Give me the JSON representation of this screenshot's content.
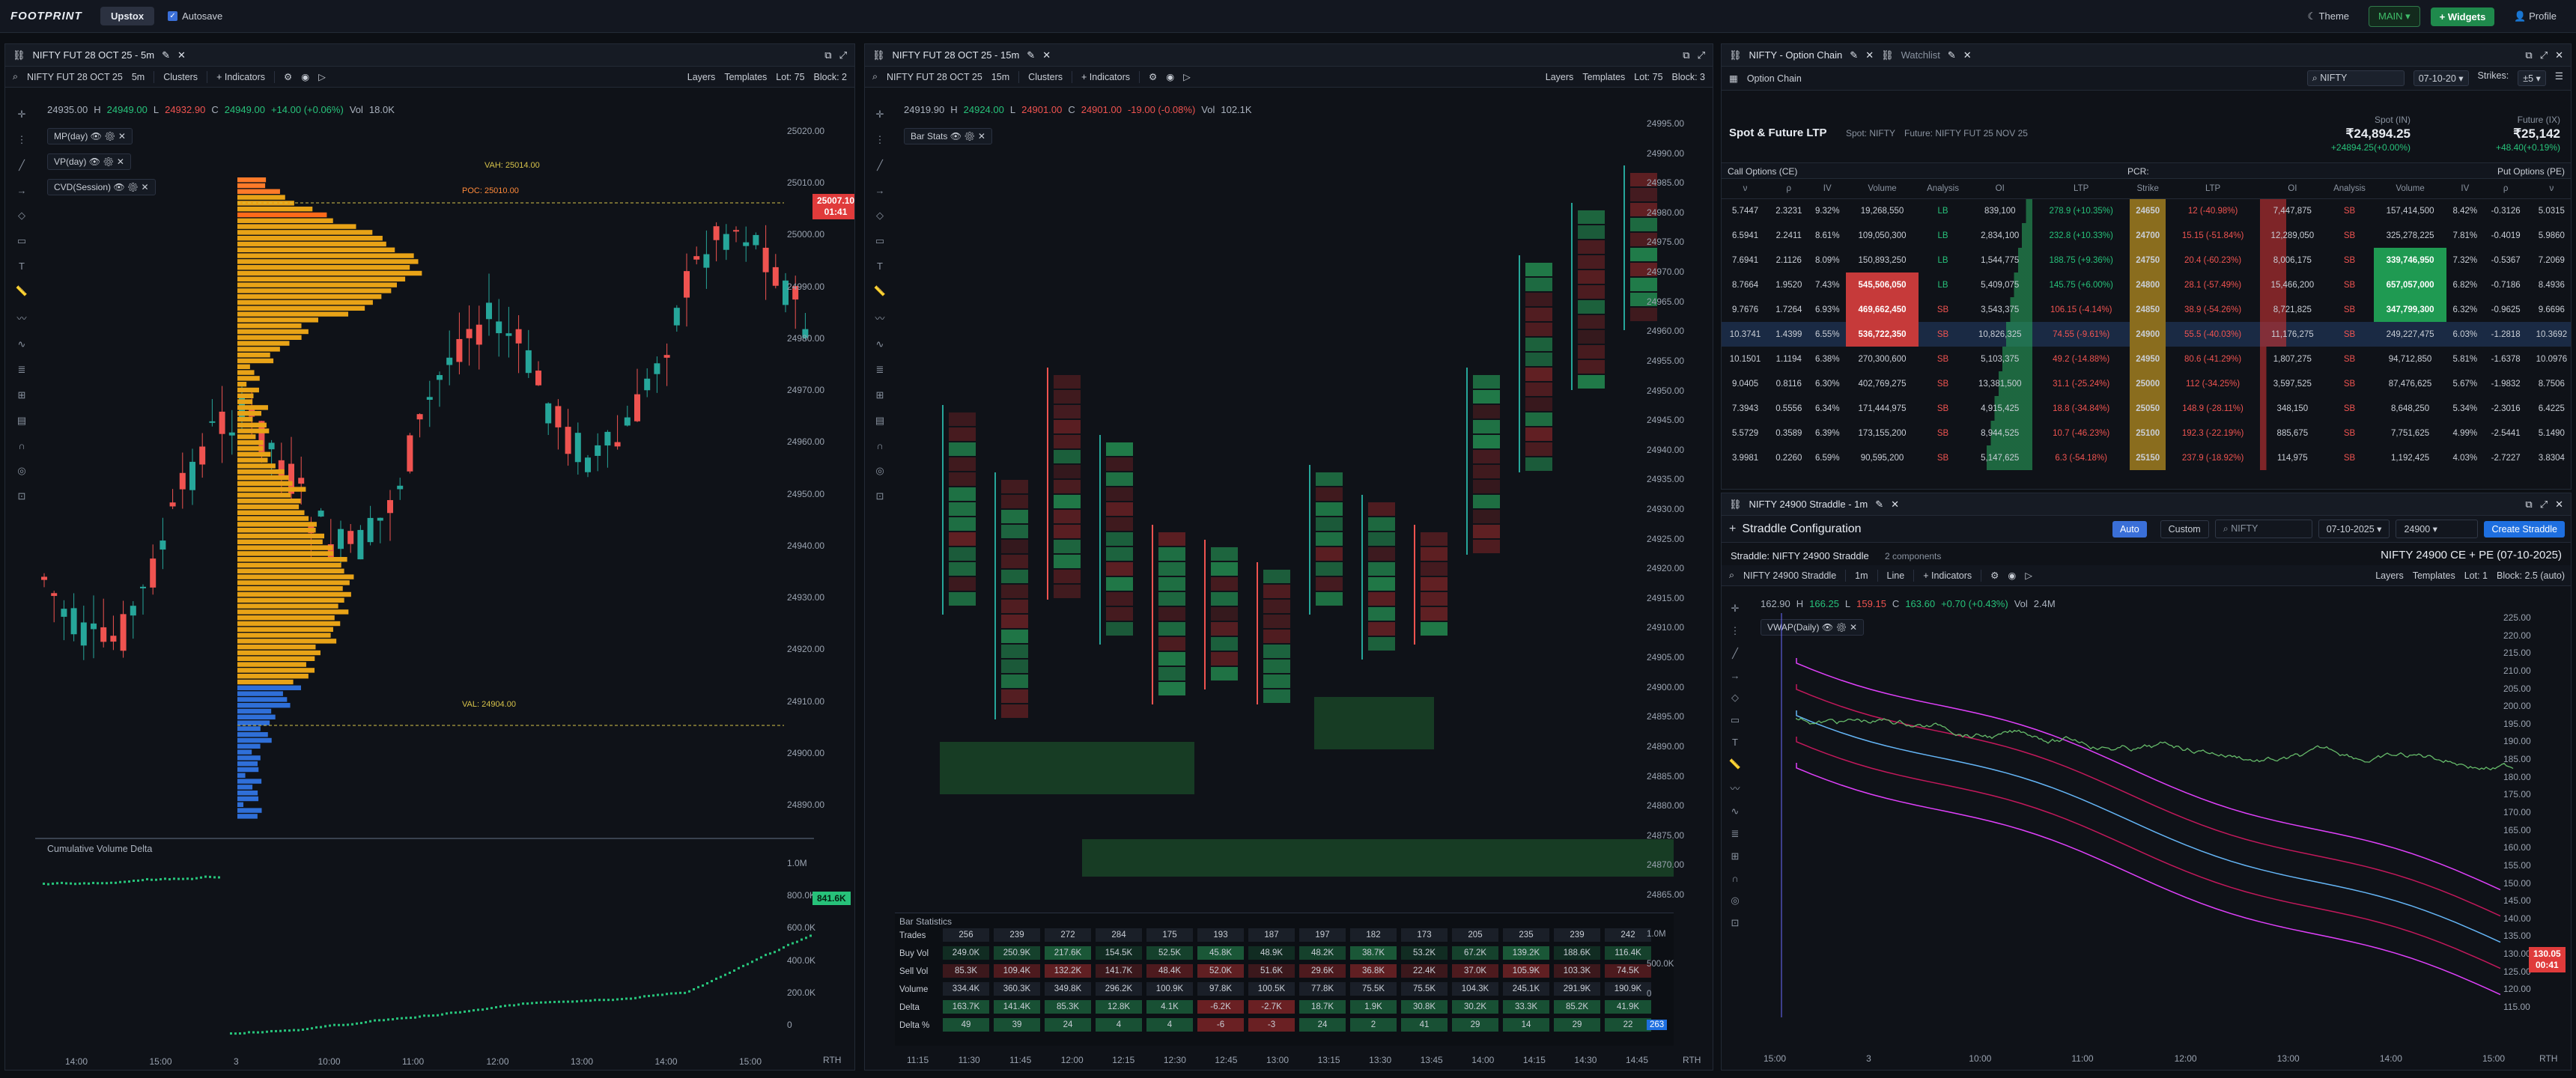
{
  "topbar": {
    "logo": "FOOTPRINT",
    "broker": "Upstox",
    "autosave": "Autosave",
    "theme": "Theme",
    "main": "MAIN",
    "widgets": "+ Widgets",
    "profile": "Profile"
  },
  "chart1": {
    "tab": "NIFTY FUT 28 OCT 25 - 5m",
    "symbol": "NIFTY FUT 28 OCT 25",
    "tf": "5m",
    "type": "Clusters",
    "indicators": "Indicators",
    "layers": "Layers",
    "templates": "Templates",
    "lot": "Lot: 75",
    "block": "Block: 2",
    "o": "24935.00",
    "h": "24949.00",
    "l": "24932.90",
    "c": "24949.00",
    "chg": "+14.00 (+0.06%)",
    "vol": "18.0K",
    "ind1": "MP(day)",
    "ind2": "VP(day)",
    "ind3": "CVD(Session)",
    "vah": "VAH: 25014.00",
    "poc": "POC: 25010.00",
    "val": "VAL: 24904.00",
    "price_tag": "25007.10",
    "time_tag": "01:41",
    "cvd_title": "Cumulative Volume Delta",
    "cvd_tag": "841.6K",
    "rth": "RTH",
    "yticks": [
      "25020.00",
      "25010.00",
      "25000.00",
      "24990.00",
      "24980.00",
      "24970.00",
      "24960.00",
      "24950.00",
      "24940.00",
      "24930.00",
      "24920.00",
      "24910.00",
      "24900.00",
      "24890.00"
    ],
    "cvd_ticks": [
      "1.0M",
      "800.0K",
      "600.0K",
      "400.0K",
      "200.0K",
      "0"
    ],
    "xticks": [
      "14:00",
      "15:00",
      "3",
      "10:00",
      "11:00",
      "12:00",
      "13:00",
      "14:00",
      "15:00"
    ]
  },
  "chart2": {
    "tab": "NIFTY FUT 28 OCT 25 - 15m",
    "symbol": "NIFTY FUT 28 OCT 25",
    "tf": "15m",
    "type": "Clusters",
    "indicators": "Indicators",
    "layers": "Layers",
    "templates": "Templates",
    "lot": "Lot: 75",
    "block": "Block: 3",
    "o": "24919.90",
    "h": "24924.00",
    "l": "24901.00",
    "c": "24901.00",
    "chg": "-19.00 (-0.08%)",
    "vol": "102.1K",
    "ind1": "Bar Stats",
    "rth": "RTH",
    "yticks": [
      "24995.00",
      "24990.00",
      "24985.00",
      "24980.00",
      "24975.00",
      "24970.00",
      "24965.00",
      "24960.00",
      "24955.00",
      "24950.00",
      "24945.00",
      "24940.00",
      "24935.00",
      "24930.00",
      "24925.00",
      "24920.00",
      "24915.00",
      "24910.00",
      "24905.00",
      "24900.00",
      "24895.00",
      "24890.00",
      "24885.00",
      "24880.00",
      "24875.00",
      "24870.00",
      "24865.00"
    ],
    "xticks": [
      "11:15",
      "11:30",
      "11:45",
      "12:00",
      "12:15",
      "12:30",
      "12:45",
      "13:00",
      "13:15",
      "13:30",
      "13:45",
      "14:00",
      "14:15",
      "14:30",
      "14:45"
    ],
    "stats": {
      "title": "Bar Statistics",
      "rows": [
        {
          "label": "Trades",
          "vals": [
            "256",
            "239",
            "272",
            "284",
            "175",
            "193",
            "187",
            "197",
            "182",
            "173",
            "205",
            "235",
            "239",
            "242"
          ]
        },
        {
          "label": "Buy Vol",
          "vals": [
            "249.0K",
            "250.9K",
            "217.6K",
            "154.5K",
            "52.5K",
            "45.8K",
            "48.9K",
            "48.2K",
            "38.7K",
            "53.2K",
            "67.2K",
            "139.2K",
            "188.6K",
            "116.4K"
          ]
        },
        {
          "label": "Sell Vol",
          "vals": [
            "85.3K",
            "109.4K",
            "132.2K",
            "141.7K",
            "48.4K",
            "52.0K",
            "51.6K",
            "29.6K",
            "36.8K",
            "22.4K",
            "37.0K",
            "105.9K",
            "103.3K",
            "74.5K"
          ]
        },
        {
          "label": "Volume",
          "vals": [
            "334.4K",
            "360.3K",
            "349.8K",
            "296.2K",
            "100.9K",
            "97.8K",
            "100.5K",
            "77.8K",
            "75.5K",
            "75.5K",
            "104.3K",
            "245.1K",
            "291.9K",
            "190.9K"
          ]
        },
        {
          "label": "Delta",
          "vals": [
            "163.7K",
            "141.4K",
            "85.3K",
            "12.8K",
            "4.1K",
            "-6.2K",
            "-2.7K",
            "18.7K",
            "1.9K",
            "30.8K",
            "30.2K",
            "33.3K",
            "85.2K",
            "41.9K"
          ]
        },
        {
          "label": "Delta %",
          "vals": [
            "49",
            "39",
            "24",
            "4",
            "4",
            "-6",
            "-3",
            "24",
            "2",
            "41",
            "29",
            "14",
            "29",
            "22"
          ]
        }
      ],
      "tags": [
        "1.0M",
        "500.0K",
        "0",
        "263"
      ]
    }
  },
  "option_chain": {
    "tab": "NIFTY - Option Chain",
    "tab2": "Watchlist",
    "title": "Option Chain",
    "search": "NIFTY",
    "expiry": "07-10-20",
    "strikes_label": "Strikes:",
    "strikes": "±5",
    "section": "Spot & Future LTP",
    "spot": "Spot: NIFTY",
    "future": "Future: NIFTY FUT 25 NOV 25",
    "spot_in": "Spot (IN)",
    "spot_val": "₹24,894.25",
    "spot_chg": "+24894.25(+0.00%)",
    "fut_in": "Future (IX)",
    "fut_val": "₹25,142",
    "fut_chg": "+48.40(+0.19%)",
    "calls": "Call Options (CE)",
    "pcr": "PCR:",
    "puts": "Put Options (PE)",
    "headers": [
      "ν",
      "ρ",
      "IV",
      "Volume",
      "Analysis",
      "OI",
      "LTP",
      "Strike",
      "LTP",
      "OI",
      "Analysis",
      "Volume",
      "IV",
      "ρ",
      "ν"
    ],
    "rows": [
      [
        "5.7447",
        "2.3231",
        "9.32%",
        "19,268,550",
        "LB",
        "839,100",
        "278.9 (+10.35%)",
        "24650",
        "12 (-40.98%)",
        "7,447,875",
        "SB",
        "157,414,500",
        "8.42%",
        "-0.3126",
        "5.0315"
      ],
      [
        "6.5941",
        "2.2411",
        "8.61%",
        "109,050,300",
        "LB",
        "2,834,100",
        "232.8 (+10.33%)",
        "24700",
        "15.15 (-51.84%)",
        "12,289,050",
        "SB",
        "325,278,225",
        "7.81%",
        "-0.4019",
        "5.9860"
      ],
      [
        "7.6941",
        "2.1126",
        "8.09%",
        "150,893,250",
        "LB",
        "1,544,775",
        "188.75 (+9.36%)",
        "24750",
        "20.4 (-60.23%)",
        "8,006,175",
        "SB",
        "339,746,950",
        "7.32%",
        "-0.5367",
        "7.2069"
      ],
      [
        "8.7664",
        "1.9520",
        "7.43%",
        "545,506,050",
        "LB",
        "5,409,075",
        "145.75 (+6.00%)",
        "24800",
        "28.1 (-57.49%)",
        "15,466,200",
        "SB",
        "657,057,000",
        "6.82%",
        "-0.7186",
        "8.4936"
      ],
      [
        "9.7676",
        "1.7264",
        "6.93%",
        "469,662,450",
        "SB",
        "3,543,375",
        "106.15 (-4.14%)",
        "24850",
        "38.9 (-54.26%)",
        "8,721,825",
        "SB",
        "347,799,300",
        "6.32%",
        "-0.9625",
        "9.6696"
      ],
      [
        "10.3741",
        "1.4399",
        "6.55%",
        "536,722,350",
        "SB",
        "10,826,325",
        "74.55 (-9.61%)",
        "24900",
        "55.5 (-40.03%)",
        "11,176,275",
        "SB",
        "249,227,475",
        "6.03%",
        "-1.2818",
        "10.3692"
      ],
      [
        "10.1501",
        "1.1194",
        "6.38%",
        "270,300,600",
        "SB",
        "5,103,375",
        "49.2 (-14.88%)",
        "24950",
        "80.6 (-41.29%)",
        "1,807,275",
        "SB",
        "94,712,850",
        "5.81%",
        "-1.6378",
        "10.0976"
      ],
      [
        "9.0405",
        "0.8116",
        "6.30%",
        "402,769,275",
        "SB",
        "13,381,500",
        "31.1 (-25.24%)",
        "25000",
        "112 (-34.25%)",
        "3,597,525",
        "SB",
        "87,476,625",
        "5.67%",
        "-1.9832",
        "8.7506"
      ],
      [
        "7.3943",
        "0.5556",
        "6.34%",
        "171,444,975",
        "SB",
        "4,915,425",
        "18.8 (-34.84%)",
        "25050",
        "148.9 (-28.11%)",
        "348,150",
        "SB",
        "8,648,250",
        "5.34%",
        "-2.3016",
        "6.4225"
      ],
      [
        "5.5729",
        "0.3589",
        "6.39%",
        "173,155,200",
        "SB",
        "8,944,525",
        "10.7 (-46.23%)",
        "25100",
        "192.3 (-22.19%)",
        "885,675",
        "SB",
        "7,751,625",
        "4.99%",
        "-2.5441",
        "5.1490"
      ],
      [
        "3.9981",
        "0.2260",
        "6.59%",
        "90,595,200",
        "SB",
        "5,147,625",
        "6.3 (-54.18%)",
        "25150",
        "237.9 (-18.92%)",
        "114,975",
        "SB",
        "1,192,425",
        "4.03%",
        "-2.7227",
        "3.8304"
      ]
    ]
  },
  "straddle": {
    "tab": "NIFTY 24900 Straddle - 1m",
    "title": "Straddle Configuration",
    "auto": "Auto",
    "custom": "Custom",
    "search": "NIFTY",
    "date": "07-10-2025",
    "strike": "24900",
    "create": "Create Straddle",
    "info": "Straddle: NIFTY 24900 Straddle",
    "components": "2 components",
    "right_title": "NIFTY 24900 CE + PE (07-10-2025)",
    "symbol": "NIFTY 24900 Straddle",
    "tf": "1m",
    "line": "Line",
    "indicators": "Indicators",
    "layers": "Layers",
    "templates": "Templates",
    "lot": "Lot: 1",
    "block": "Block: 2.5 (auto)",
    "o": "162.90",
    "h": "166.25",
    "l": "159.15",
    "c": "163.60",
    "chg": "+0.70 (+0.43%)",
    "vol": "2.4M",
    "vwap": "VWAP(Daily)",
    "price_tag": "130.05",
    "time_tag": "00:41",
    "rth": "RTH",
    "yticks": [
      "225.00",
      "220.00",
      "215.00",
      "210.00",
      "205.00",
      "200.00",
      "195.00",
      "190.00",
      "185.00",
      "180.00",
      "175.00",
      "170.00",
      "165.00",
      "160.00",
      "155.00",
      "150.00",
      "145.00",
      "140.00",
      "135.00",
      "130.00",
      "125.00",
      "120.00",
      "115.00"
    ],
    "xticks": [
      "15:00",
      "3",
      "10:00",
      "11:00",
      "12:00",
      "13:00",
      "14:00",
      "15:00"
    ]
  },
  "colors": {
    "up": "#26a69a",
    "down": "#ef5350",
    "accent": "#3a6fd8",
    "green": "#1f8a4c"
  }
}
